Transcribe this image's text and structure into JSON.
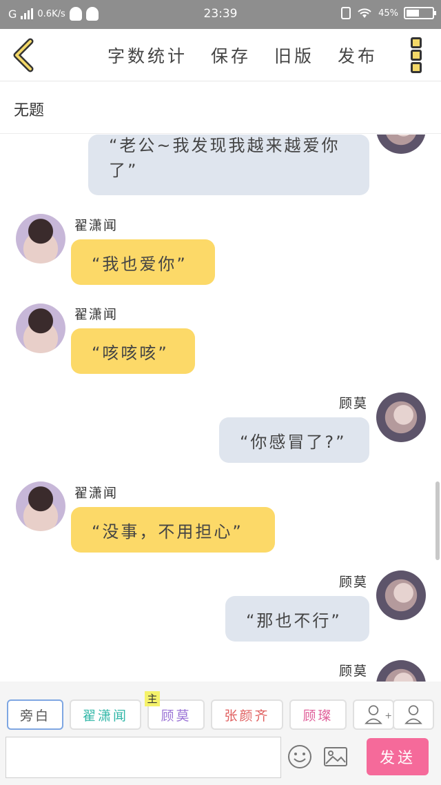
{
  "status_bar": {
    "carrier": "G",
    "speed": "0.6K/s",
    "time": "23:39",
    "battery": "45%"
  },
  "toolbar": {
    "word_count": "字数统计",
    "save": "保存",
    "old_version": "旧版",
    "publish": "发布"
  },
  "document": {
    "title": "无题"
  },
  "messages": [
    {
      "sender": "",
      "side": "right",
      "text": "“老公~我发现我越来越爱你了”"
    },
    {
      "sender": "翟潇闻",
      "side": "left",
      "text": "“我也爱你”"
    },
    {
      "sender": "翟潇闻",
      "side": "left",
      "text": "“咳咳咳”"
    },
    {
      "sender": "顾莫",
      "side": "right",
      "text": "“你感冒了?”"
    },
    {
      "sender": "翟潇闻",
      "side": "left",
      "text": "“没事，不用担心”"
    },
    {
      "sender": "顾莫",
      "side": "right",
      "text": "“那也不行”"
    },
    {
      "sender": "顾莫",
      "side": "right",
      "text": ""
    }
  ],
  "characters": [
    {
      "name": "旁白",
      "color": "#555555"
    },
    {
      "name": "翟潇闻",
      "color": "#33b7a8"
    },
    {
      "name": "顾莫",
      "color": "#9b74d6",
      "badge": "主"
    },
    {
      "name": "张颜齐",
      "color": "#e06060"
    },
    {
      "name": "顾璨",
      "color": "#e0609a"
    }
  ],
  "composer": {
    "send_label": "发送"
  }
}
